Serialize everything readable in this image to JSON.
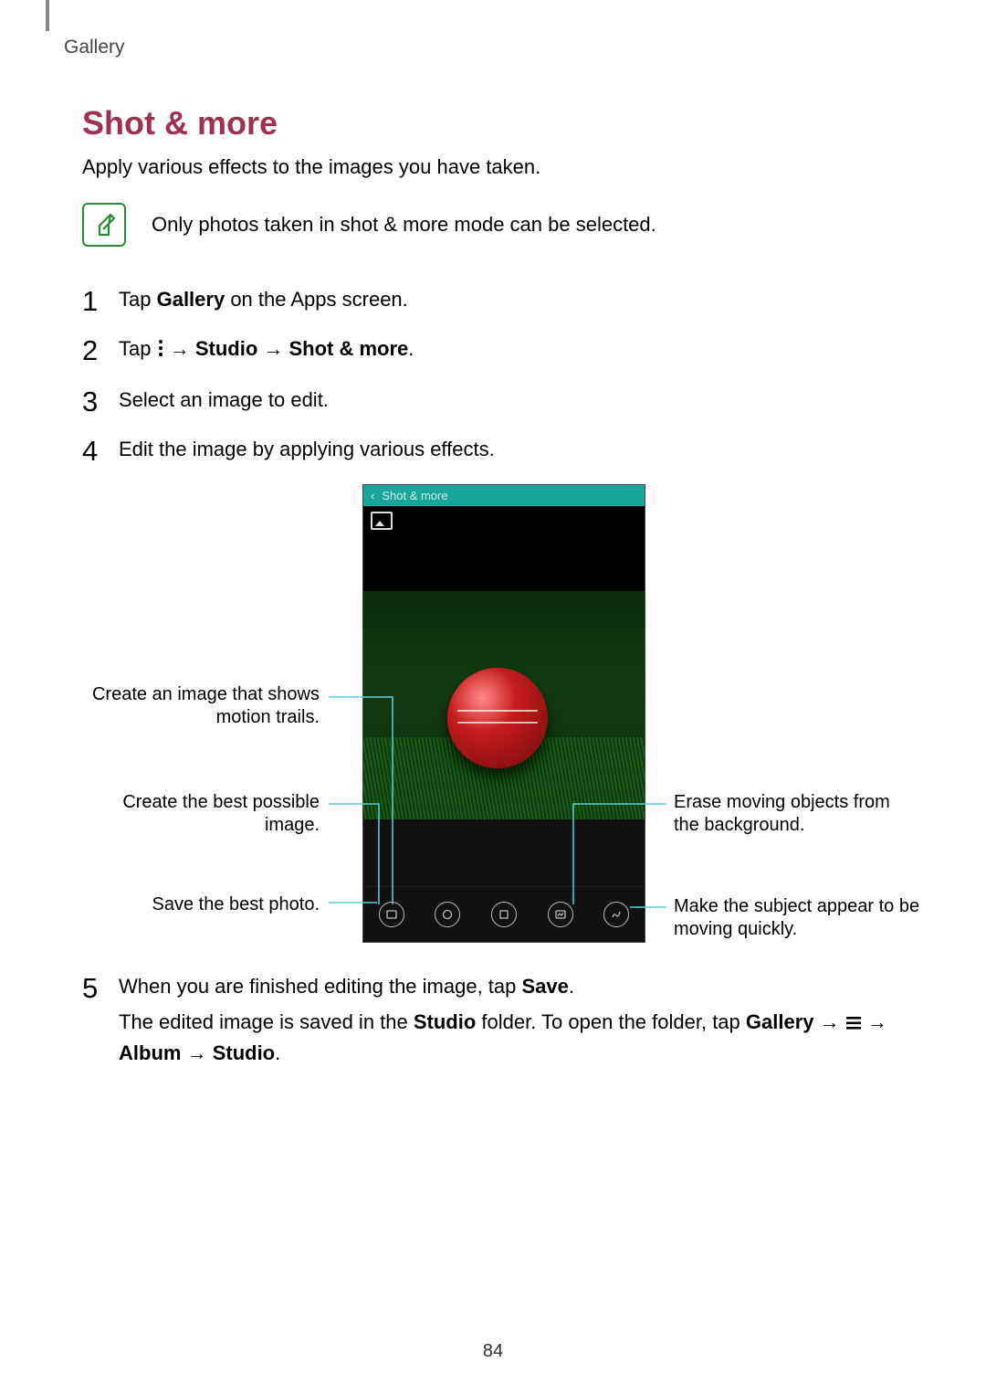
{
  "section": "Gallery",
  "title": "Shot & more",
  "intro": "Apply various effects to the images you have taken.",
  "note": "Only photos taken in shot & more mode can be selected.",
  "steps": {
    "s1_a": "Tap ",
    "s1_b": "Gallery",
    "s1_c": " on the Apps screen.",
    "s2_a": "Tap ",
    "s2_b": " → ",
    "s2_c": "Studio",
    "s2_d": " → ",
    "s2_e": "Shot & more",
    "s2_f": ".",
    "s3": "Select an image to edit.",
    "s4": "Edit the image by applying various effects.",
    "s5_a": "When you are finished editing the image, tap ",
    "s5_b": "Save",
    "s5_c": ".",
    "s5_p2_a": "The edited image is saved in the ",
    "s5_p2_b": "Studio",
    "s5_p2_c": " folder. To open the folder, tap ",
    "s5_p2_d": "Gallery",
    "s5_p2_e": " → ",
    "s5_p2_f": " → ",
    "s5_p2_g": "Album",
    "s5_p2_h": " → ",
    "s5_p2_i": "Studio",
    "s5_p2_j": "."
  },
  "phone": {
    "header": "Shot & more"
  },
  "callouts": {
    "motion_trails": "Create an image that shows motion trails.",
    "best_image": "Create the best possible image.",
    "save_best": "Save the best photo.",
    "eraser": "Erase moving objects from the background.",
    "panning": "Make the subject appear to be moving quickly."
  },
  "page_number": "84"
}
